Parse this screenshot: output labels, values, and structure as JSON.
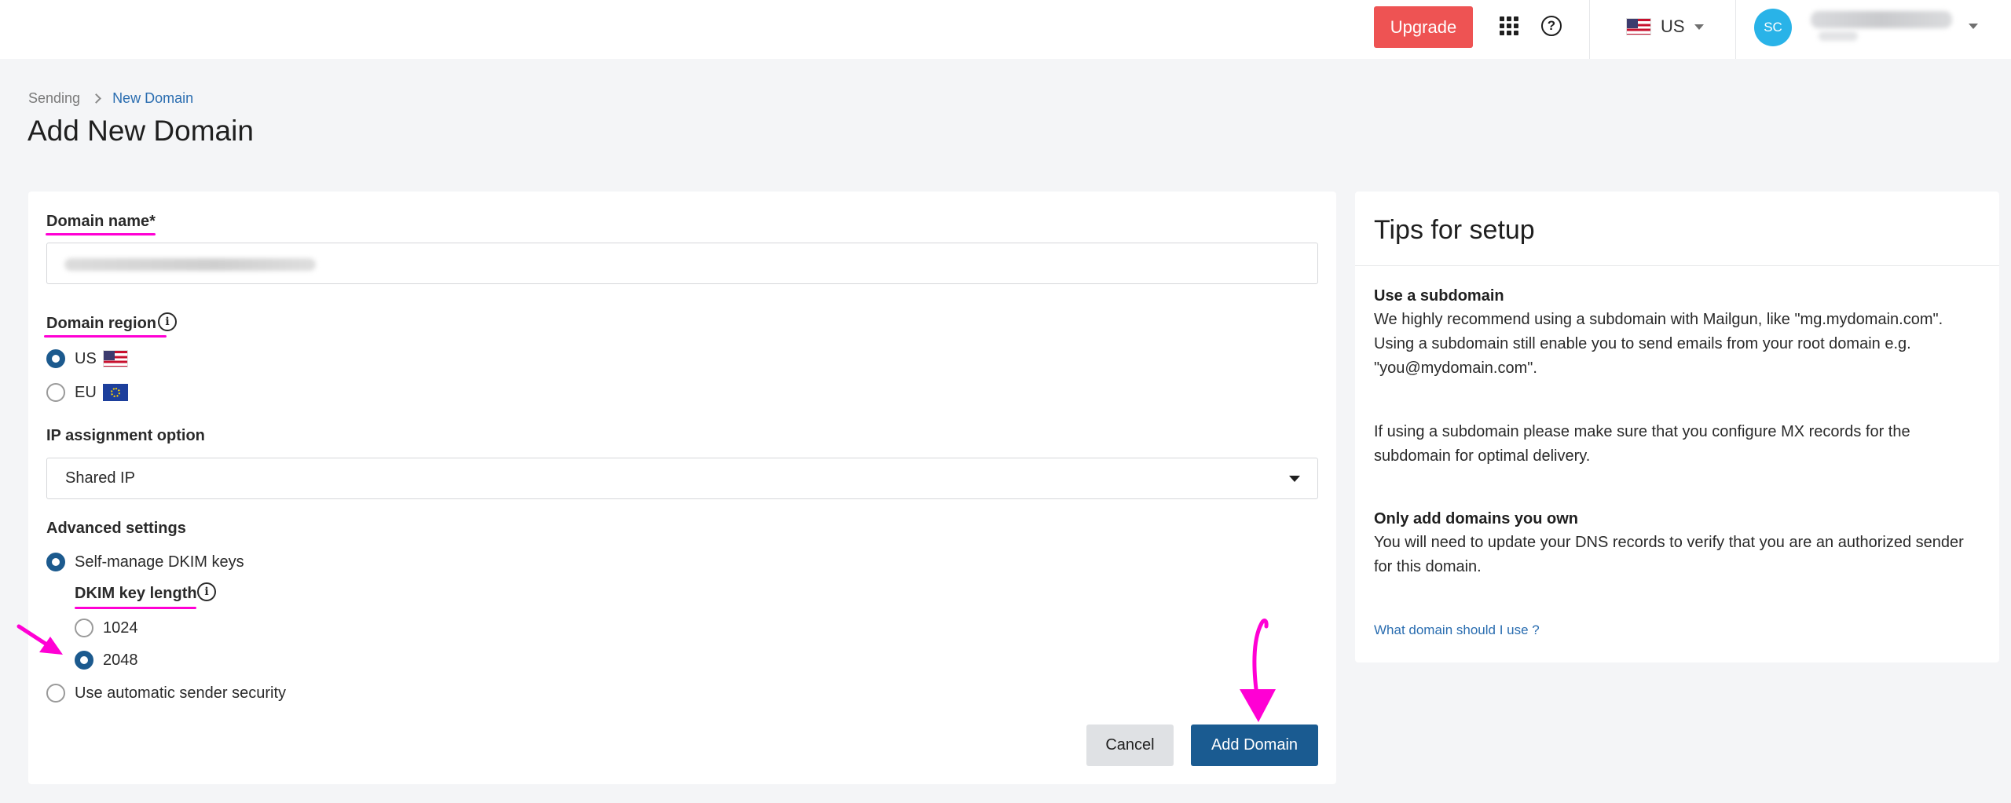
{
  "topbar": {
    "upgrade_label": "Upgrade",
    "region_label": "US",
    "avatar_initials": "SC"
  },
  "breadcrumb": {
    "parent": "Sending",
    "current": "New Domain"
  },
  "page": {
    "title": "Add New Domain"
  },
  "form": {
    "domain_name": {
      "label": "Domain name*"
    },
    "domain_region": {
      "label": "Domain region",
      "options": [
        {
          "label": "US",
          "selected": true
        },
        {
          "label": "EU",
          "selected": false
        }
      ]
    },
    "ip_assignment": {
      "label": "IP assignment option",
      "selected": "Shared IP"
    },
    "advanced": {
      "label": "Advanced settings",
      "self_manage_label": "Self-manage DKIM keys",
      "dkim_key_length": {
        "label": "DKIM key length",
        "options": [
          {
            "label": "1024",
            "selected": false
          },
          {
            "label": "2048",
            "selected": true
          }
        ]
      },
      "auto_security_label": "Use automatic sender security"
    },
    "cancel_label": "Cancel",
    "submit_label": "Add Domain"
  },
  "tips": {
    "title": "Tips for setup",
    "sections": [
      {
        "heading": "Use a subdomain",
        "body": "We highly recommend using a subdomain with Mailgun, like \"mg.mydomain.com\". Using a subdomain still enable you to send emails from your root domain e.g. \"you@mydomain.com\"."
      },
      {
        "heading": "",
        "body": "If using a subdomain please make sure that you configure MX records for the subdomain for optimal delivery."
      },
      {
        "heading": "Only add domains you own",
        "body": "You will need to update your DNS records to verify that you are an authorized sender for this domain."
      }
    ],
    "link": "What domain should I use ?"
  },
  "colors": {
    "primary": "#1a5b91",
    "upgrade": "#ee5353",
    "annotation": "#ff00d4",
    "avatar": "#29b3e8"
  }
}
